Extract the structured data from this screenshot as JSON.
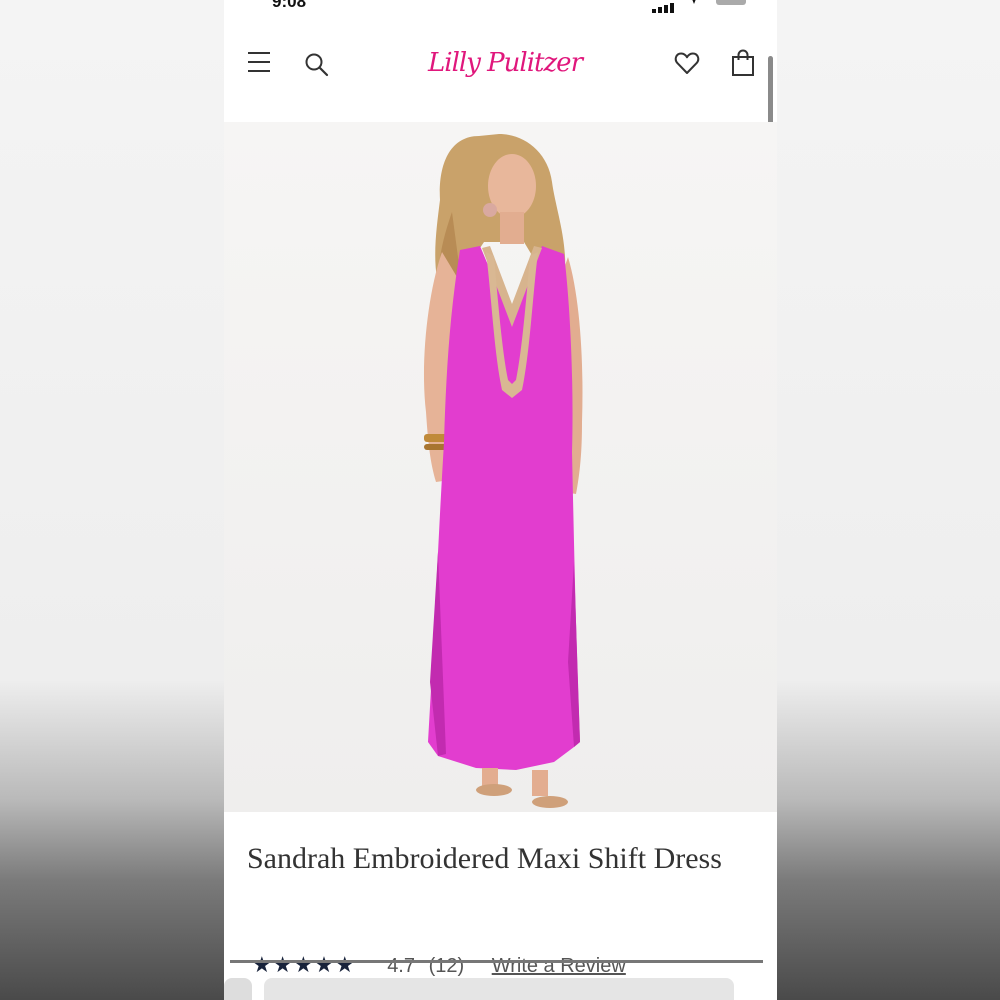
{
  "status_bar": {
    "time": "9:08"
  },
  "header": {
    "logo_text": "Lilly Pulitzer",
    "menu_icon": "hamburger-menu-icon",
    "search_icon": "search-icon",
    "wishlist_icon": "heart-icon",
    "bag_icon": "shopping-bag-icon"
  },
  "product": {
    "image": "model-in-pink-maxi-dress",
    "title": "Sandrah Embroidered Maxi Shift Dress",
    "stars": "★★★★★",
    "rating": "4.7",
    "review_count": "(12)",
    "write_review_label": "Write a Review"
  },
  "colors": {
    "brand_pink": "#e0177c",
    "dress_pink": "#e23dcf",
    "star_navy": "#17223a"
  }
}
